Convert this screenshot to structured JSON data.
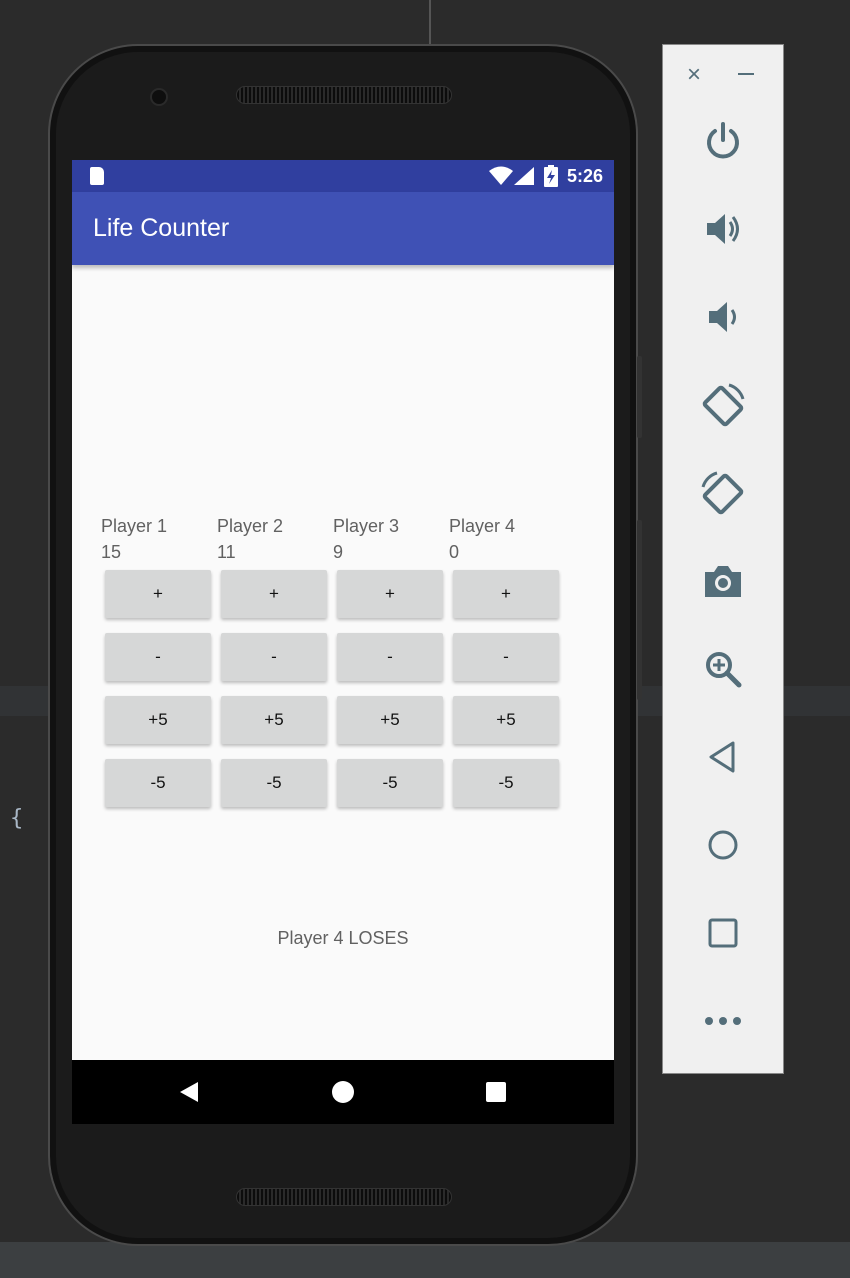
{
  "status_bar": {
    "time": "5:26"
  },
  "app": {
    "title": "Life Counter"
  },
  "players": [
    {
      "name": "Player 1",
      "life": "15"
    },
    {
      "name": "Player 2",
      "life": "11"
    },
    {
      "name": "Player 3",
      "life": "9"
    },
    {
      "name": "Player 4",
      "life": "0"
    }
  ],
  "buttons": {
    "plus": "+",
    "minus": "-",
    "plus5": "+5",
    "minus5": "-5"
  },
  "result": "Player 4 LOSES",
  "emulator_panel": {
    "close": "×",
    "icons": [
      "power-icon",
      "volume-up-icon",
      "volume-down-icon",
      "rotate-left-icon",
      "rotate-right-icon",
      "camera-icon",
      "zoom-icon",
      "back-icon",
      "home-icon",
      "overview-icon",
      "more-icon"
    ]
  },
  "ide": {
    "brace": "{"
  },
  "colors": {
    "status_bar": "#303f9f",
    "app_bar": "#3f51b5",
    "button": "#d6d7d7",
    "emulator_icon": "#546e7a"
  }
}
